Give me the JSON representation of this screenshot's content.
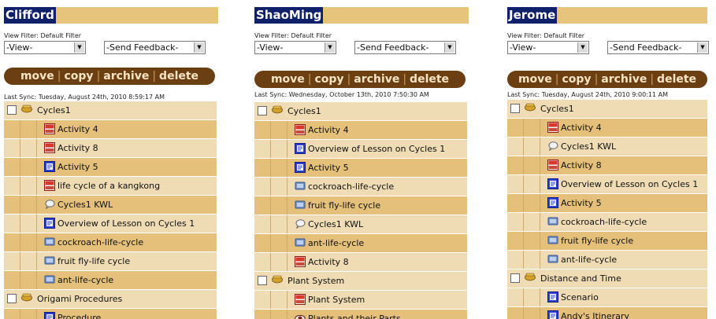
{
  "colors": {
    "name_highlight": "#10206a",
    "name_bar": "#e6c47c",
    "action_bar": "#6b3f12",
    "row_light": "#efdcb4",
    "row_dark": "#e4c07a"
  },
  "panels": [
    {
      "name": "Clifford",
      "filter_label": "View Filter: Default Filter",
      "view_select": "-View-",
      "feedback_select": "-Send Feedback-",
      "actions": [
        "move",
        "copy",
        "archive",
        "delete"
      ],
      "last_sync": "Last Sync: Tuesday, August 24th, 2010 8:59:17 AM",
      "tree": [
        {
          "type": "folder",
          "label": "Cycles1",
          "icon": "folder-icon"
        },
        {
          "type": "item",
          "label": "Activity 4",
          "icon": "activity-red-icon"
        },
        {
          "type": "item",
          "label": "Activity 8",
          "icon": "activity-red-icon"
        },
        {
          "type": "item",
          "label": "Activity 5",
          "icon": "lesson-blue-icon"
        },
        {
          "type": "item",
          "label": "life cycle of a kangkong",
          "icon": "activity-red-icon"
        },
        {
          "type": "item",
          "label": "Cycles1 KWL",
          "icon": "kwl-icon"
        },
        {
          "type": "item",
          "label": "Overview of Lesson on Cycles 1",
          "icon": "lesson-blue-icon"
        },
        {
          "type": "item",
          "label": "cockroach-life-cycle",
          "icon": "media-icon"
        },
        {
          "type": "item",
          "label": "fruit fly-life cycle",
          "icon": "media-icon"
        },
        {
          "type": "item",
          "label": "ant-life-cycle",
          "icon": "media-icon"
        },
        {
          "type": "folder",
          "label": "Origami Procedures",
          "icon": "folder-icon"
        },
        {
          "type": "item",
          "label": "Procedure",
          "icon": "lesson-blue-icon"
        }
      ]
    },
    {
      "name": "ShaoMing",
      "filter_label": "View Filter: Default Filter",
      "view_select": "-View-",
      "feedback_select": "-Send Feedback-",
      "actions": [
        "move",
        "copy",
        "archive",
        "delete"
      ],
      "last_sync": "Last Sync: Wednesday, October 13th, 2010 7:50:30 AM",
      "tree": [
        {
          "type": "folder",
          "label": "Cycles1",
          "icon": "folder-icon"
        },
        {
          "type": "item",
          "label": "Activity 4",
          "icon": "activity-red-icon"
        },
        {
          "type": "item",
          "label": "Overview of Lesson on Cycles 1",
          "icon": "lesson-blue-icon"
        },
        {
          "type": "item",
          "label": "Activity 5",
          "icon": "lesson-blue-icon"
        },
        {
          "type": "item",
          "label": "cockroach-life-cycle",
          "icon": "media-icon"
        },
        {
          "type": "item",
          "label": "fruit fly-life cycle",
          "icon": "media-icon"
        },
        {
          "type": "item",
          "label": "Cycles1 KWL",
          "icon": "kwl-icon"
        },
        {
          "type": "item",
          "label": "ant-life-cycle",
          "icon": "media-icon"
        },
        {
          "type": "item",
          "label": "Activity 8",
          "icon": "activity-red-icon"
        },
        {
          "type": "folder",
          "label": "Plant System",
          "icon": "folder-icon"
        },
        {
          "type": "item",
          "label": "Plant System",
          "icon": "activity-red-icon"
        },
        {
          "type": "item",
          "label": "Plants and their Parts",
          "icon": "eye-icon"
        }
      ]
    },
    {
      "name": "Jerome",
      "filter_label": "View Filter: Default Filter",
      "view_select": "-View-",
      "feedback_select": "-Send Feedback-",
      "actions": [
        "move",
        "copy",
        "archive",
        "delete"
      ],
      "last_sync": "Last Sync: Tuesday, August 24th, 2010 9:00:11 AM",
      "tree": [
        {
          "type": "folder",
          "label": "Cycles1",
          "icon": "folder-icon"
        },
        {
          "type": "item",
          "label": "Activity 4",
          "icon": "activity-red-icon"
        },
        {
          "type": "item",
          "label": "Cycles1 KWL",
          "icon": "kwl-icon"
        },
        {
          "type": "item",
          "label": "Activity 8",
          "icon": "activity-red-icon"
        },
        {
          "type": "item",
          "label": "Overview of Lesson on Cycles 1",
          "icon": "lesson-blue-icon"
        },
        {
          "type": "item",
          "label": "Activity 5",
          "icon": "lesson-blue-icon"
        },
        {
          "type": "item",
          "label": "cockroach-life-cycle",
          "icon": "media-icon"
        },
        {
          "type": "item",
          "label": "fruit fly-life cycle",
          "icon": "media-icon"
        },
        {
          "type": "item",
          "label": "ant-life-cycle",
          "icon": "media-icon"
        },
        {
          "type": "folder",
          "label": "Distance and Time",
          "icon": "folder-icon"
        },
        {
          "type": "item",
          "label": "Scenario",
          "icon": "lesson-blue-icon"
        },
        {
          "type": "item",
          "label": "Andy's Itinerary",
          "icon": "lesson-blue-icon"
        }
      ]
    }
  ]
}
